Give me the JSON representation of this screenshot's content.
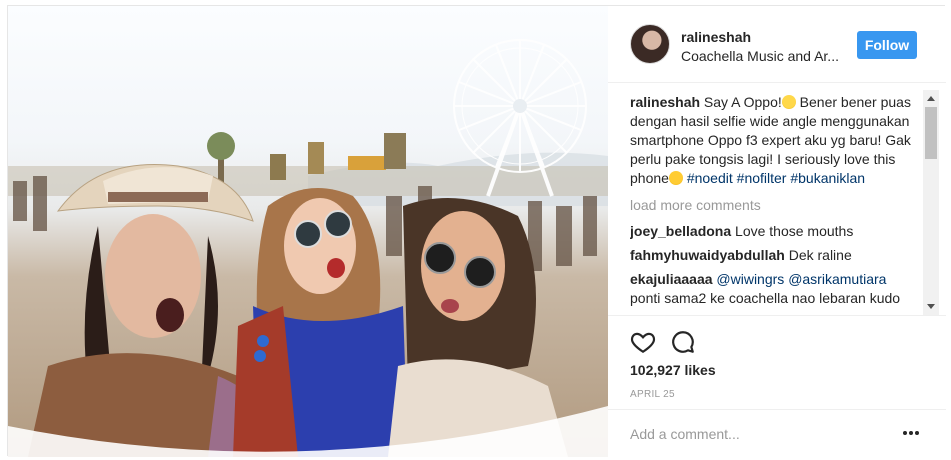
{
  "post": {
    "photo_alt": "Three women taking a selfie at a festival with a ferris wheel",
    "author": {
      "username": "ralineshah",
      "location": "Coachella Music and Ar..."
    },
    "follow_label": "Follow",
    "caption": {
      "username": "ralineshah",
      "text_part1": "Say A Oppo!",
      "text_part2": " Bener bener puas dengan hasil selfie wide angle menggunakan smartphone Oppo f3 expert aku yg baru! Gak perlu pake tongsis lagi! I seriously love this phone",
      "hashtags": [
        "#noedit",
        "#nofilter",
        "#bukaniklan"
      ]
    },
    "load_more_label": "load more comments",
    "comments": [
      {
        "username": "joey_belladona",
        "text": "Love those mouths"
      },
      {
        "username": "fahmyhuwaidyabdullah",
        "text": "Dek raline"
      },
      {
        "username": "ekajuliaaaaa",
        "mention1": "@wiwingrs",
        "mention2": "@asrikamutiara",
        "text": "ponti sama2 ke coachella nao lebaran kudo"
      }
    ],
    "likes": "102,927 likes",
    "date": "APRIL 25",
    "comment_placeholder": "Add a comment...",
    "icons": [
      "heart-icon",
      "comment-icon",
      "more-options-icon"
    ],
    "colors": {
      "accent": "#3897f0",
      "hashtag": "#003569",
      "muted": "#999999"
    }
  }
}
